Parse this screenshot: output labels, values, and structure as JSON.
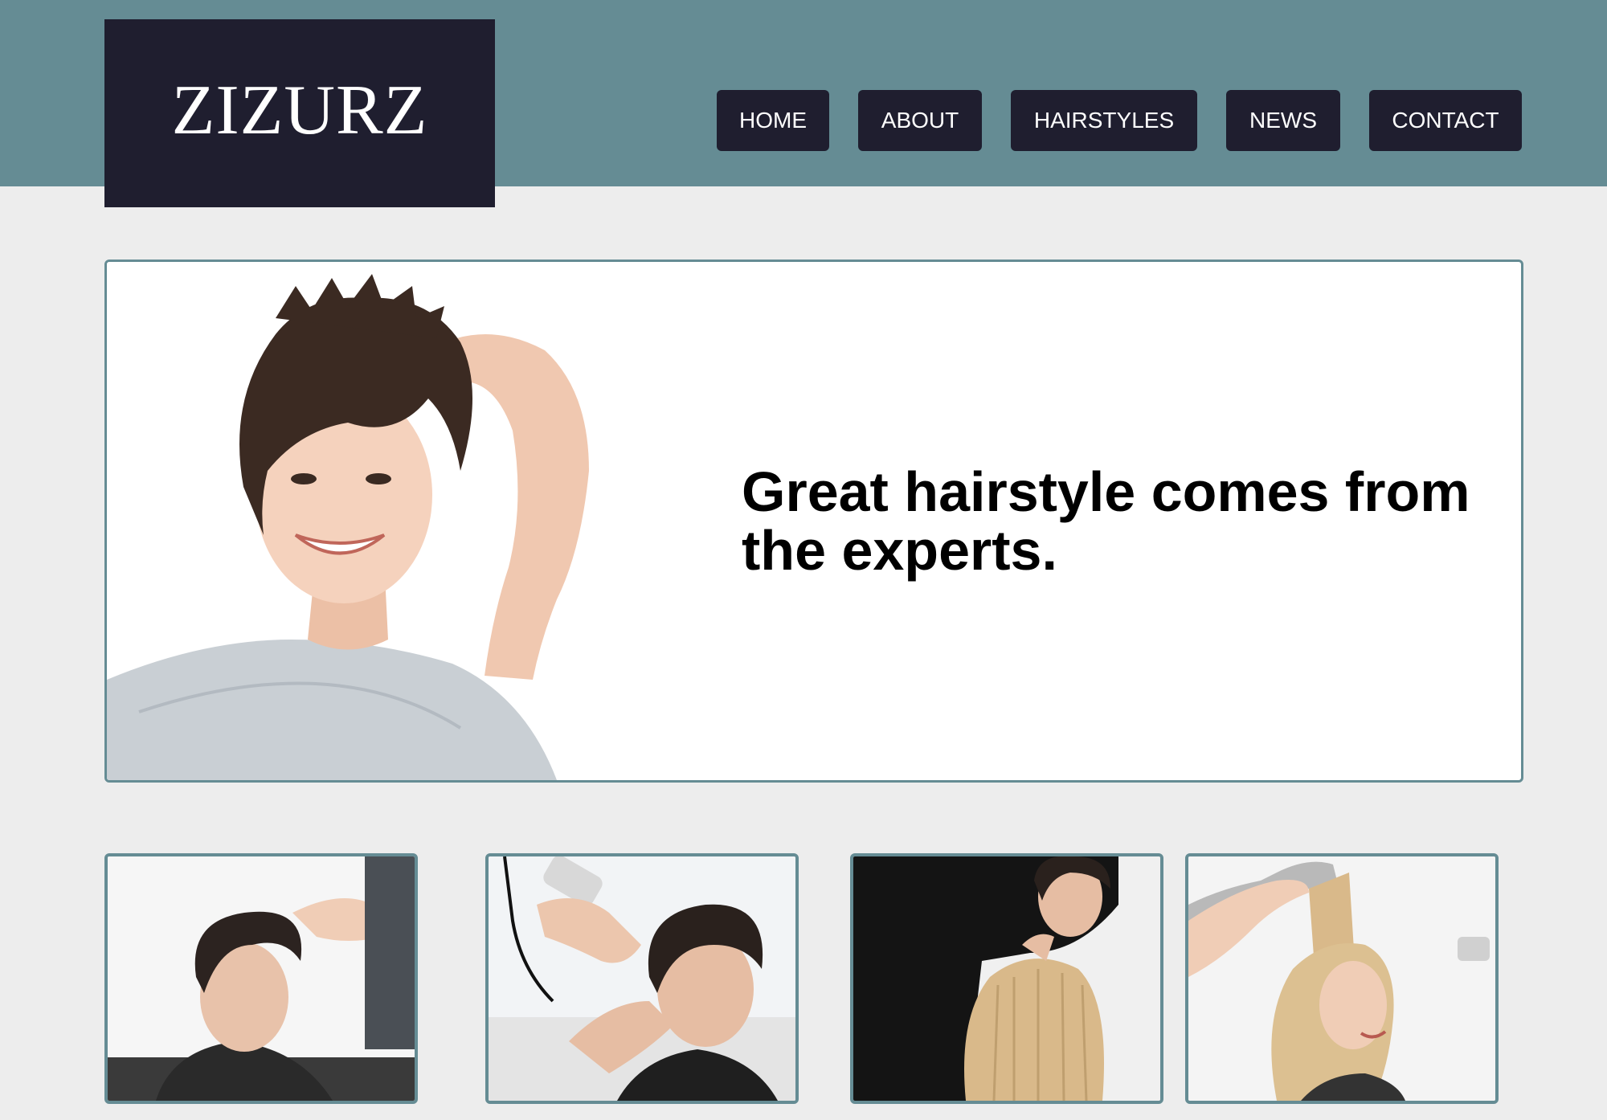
{
  "brand": {
    "logo_text": "ZIZURZ"
  },
  "nav": {
    "items": [
      {
        "label": "HOME"
      },
      {
        "label": "ABOUT"
      },
      {
        "label": "HAIRSTYLES"
      },
      {
        "label": "NEWS"
      },
      {
        "label": "CONTACT"
      }
    ]
  },
  "hero": {
    "headline": "Great hairstyle comes from the experts.",
    "image": "smiling-woman-short-hair-photo"
  },
  "gallery": {
    "images": [
      "man-haircut-scissors-photo",
      "man-haircut-clippers-photo",
      "stylist-cutting-blonde-hair-photo",
      "woman-blonde-hair-lifted-photo"
    ]
  },
  "colors": {
    "header_bg": "#658c94",
    "nav_bg": "#1f1e2f",
    "page_bg": "#ededed",
    "border": "#658c94"
  }
}
